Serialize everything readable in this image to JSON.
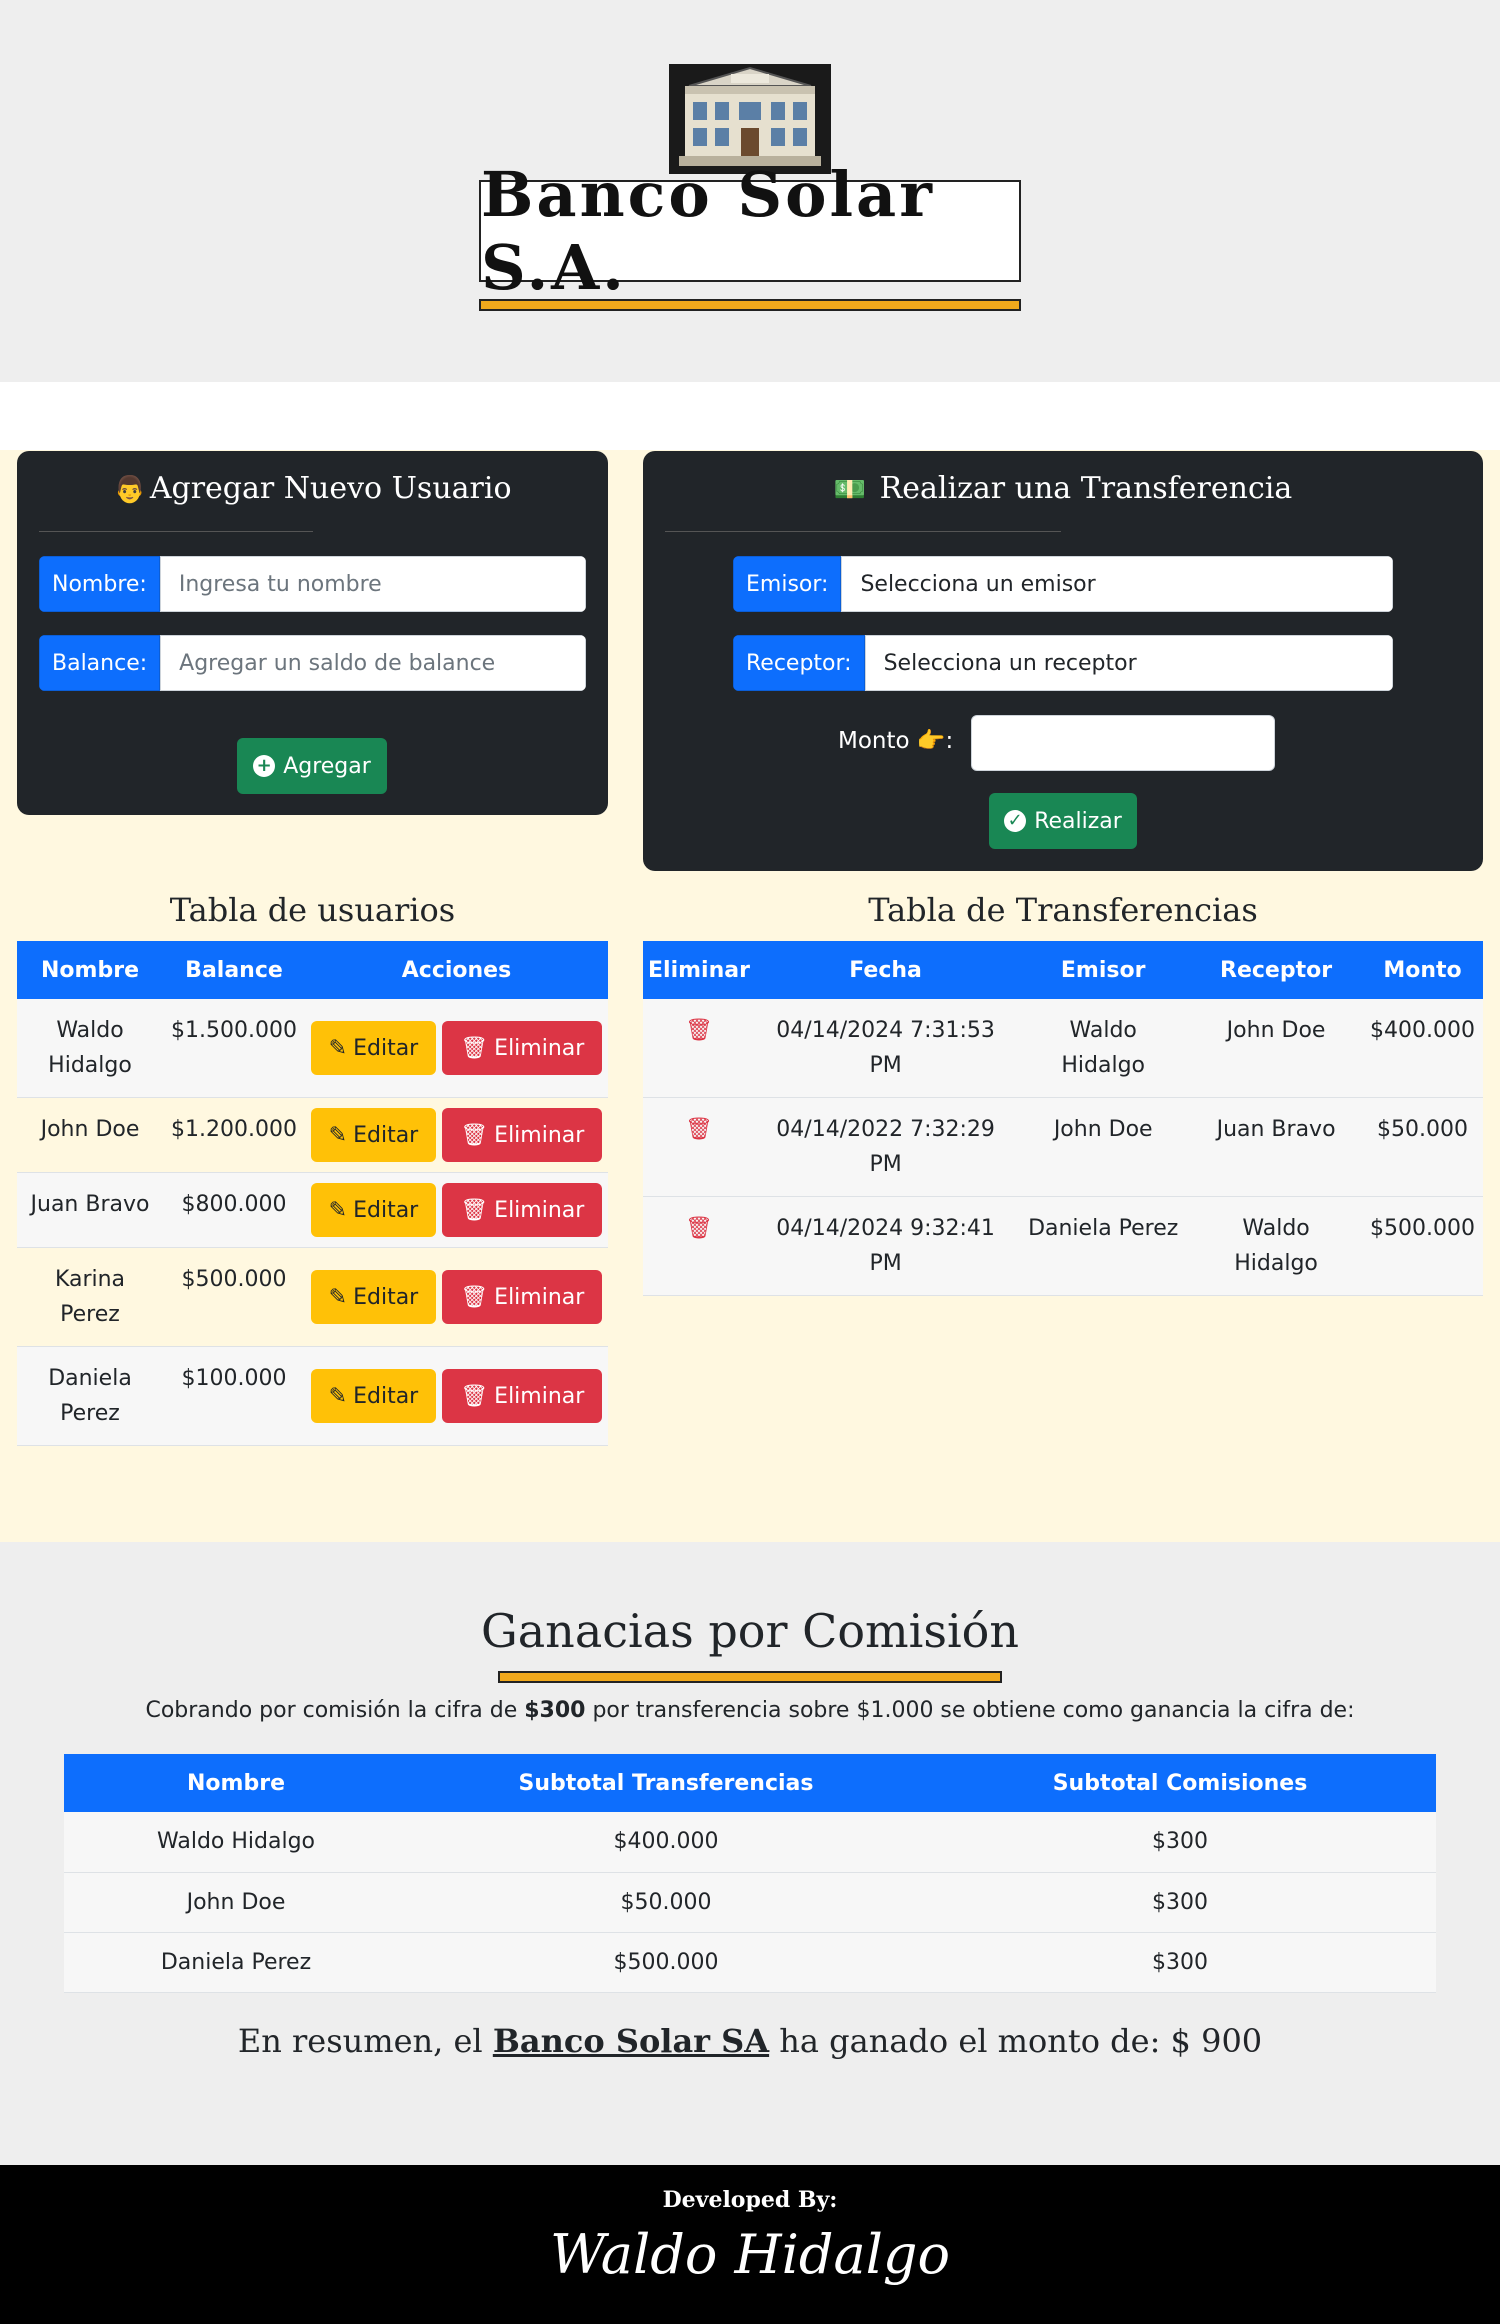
{
  "header": {
    "bank_title": "Banco Solar S.A."
  },
  "add_user": {
    "title": "Agregar Nuevo Usuario",
    "name_label": "Nombre:",
    "name_placeholder": "Ingresa tu nombre",
    "balance_label": "Balance:",
    "balance_placeholder": "Agregar un saldo de balance",
    "button": "Agregar"
  },
  "transfer": {
    "title": "Realizar una Transferencia",
    "sender_label": "Emisor:",
    "sender_value": "Selecciona un emisor",
    "receiver_label": "Receptor:",
    "receiver_value": "Selecciona un receptor",
    "amount_label": "Monto",
    "button": "Realizar"
  },
  "users_table": {
    "title": "Tabla de usuarios",
    "headers": [
      "Nombre",
      "Balance",
      "Acciones"
    ],
    "edit_label": "Editar",
    "delete_label": "Eliminar",
    "rows": [
      {
        "name": "Waldo Hidalgo",
        "balance": "$1.500.000"
      },
      {
        "name": "John Doe",
        "balance": "$1.200.000"
      },
      {
        "name": "Juan Bravo",
        "balance": "$800.000"
      },
      {
        "name": "Karina Perez",
        "balance": "$500.000"
      },
      {
        "name": "Daniela Perez",
        "balance": "$100.000"
      }
    ]
  },
  "transfers_table": {
    "title": "Tabla de Transferencias",
    "headers": [
      "Eliminar",
      "Fecha",
      "Emisor",
      "Receptor",
      "Monto"
    ],
    "rows": [
      {
        "date": "04/14/2024 7:31:53 PM",
        "sender": "Waldo Hidalgo",
        "receiver": "John Doe",
        "amount": "$400.000"
      },
      {
        "date": "04/14/2022 7:32:29 PM",
        "sender": "John Doe",
        "receiver": "Juan Bravo",
        "amount": "$50.000"
      },
      {
        "date": "04/14/2024 9:32:41 PM",
        "sender": "Daniela Perez",
        "receiver": "Waldo Hidalgo",
        "amount": "$500.000"
      }
    ]
  },
  "commission": {
    "title": "Ganacias por Comisión",
    "text_before": "Cobrando por comisión la cifra de ",
    "text_bold": "$300",
    "text_after": " por transferencia sobre $1.000 se obtiene como ganancia la cifra de:",
    "headers": [
      "Nombre",
      "Subtotal Transferencias",
      "Subtotal Comisiones"
    ],
    "rows": [
      {
        "name": "Waldo Hidalgo",
        "subtotal": "$400.000",
        "commission": "$300"
      },
      {
        "name": "John Doe",
        "subtotal": "$50.000",
        "commission": "$300"
      },
      {
        "name": "Daniela Perez",
        "subtotal": "$500.000",
        "commission": "$300"
      }
    ],
    "summary_before": "En resumen, el ",
    "summary_brand": "Banco Solar SA",
    "summary_after": " ha ganado el monto de: $ 900"
  },
  "footer": {
    "developed_by": "Developed By:",
    "signature": "Waldo Hidalgo"
  },
  "colors": {
    "primary": "#0d6efd",
    "success": "#198754",
    "warning": "#ffc107",
    "danger": "#dc3545",
    "accent": "#f0a81c",
    "panel": "#212529"
  }
}
